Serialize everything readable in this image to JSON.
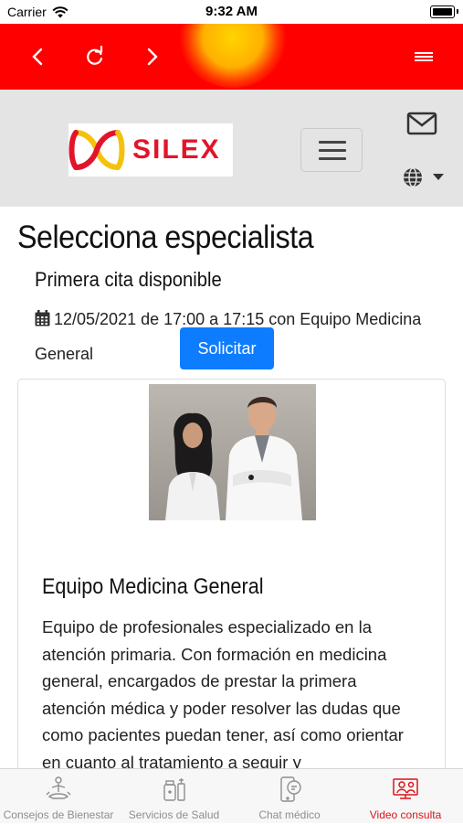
{
  "status_bar": {
    "carrier": "Carrier",
    "time": "9:32 AM"
  },
  "top_nav": {
    "back_icon": "chevron-left-icon",
    "reload_icon": "reload-icon",
    "forward_icon": "chevron-right-icon",
    "menu_icon": "menu-icon"
  },
  "header": {
    "logo_text": "SILEX",
    "mail_icon": "envelope-icon",
    "language_icon": "globe-icon"
  },
  "main": {
    "title": "Selecciona especialista",
    "subtitle": "Primera cita disponible",
    "appointment_text": "12/05/2021 de 17:00 a 17:15 con Equipo Medicina General",
    "request_button": "Solicitar"
  },
  "card": {
    "title": "Equipo Medicina General",
    "description": "Equipo de profesionales especializado en la atención primaria. Con formación en medicina general, encargados de prestar la primera atención médica y poder resolver las dudas que como pacientes puedan tener, así como orientar en cuanto al tratamiento a seguir y"
  },
  "tabs": [
    {
      "label": "Consejos de Bienestar",
      "icon": "meditation-icon",
      "active": false
    },
    {
      "label": "Servicios de Salud",
      "icon": "medicine-icon",
      "active": false
    },
    {
      "label": "Chat médico",
      "icon": "chat-phone-icon",
      "active": false
    },
    {
      "label": "Video consulta",
      "icon": "video-doctor-icon",
      "active": true
    }
  ],
  "colors": {
    "nav_red": "#ff0000",
    "button_blue": "#0d7cff",
    "active_tab": "#d9151b",
    "header_gray": "#e4e4e4"
  }
}
